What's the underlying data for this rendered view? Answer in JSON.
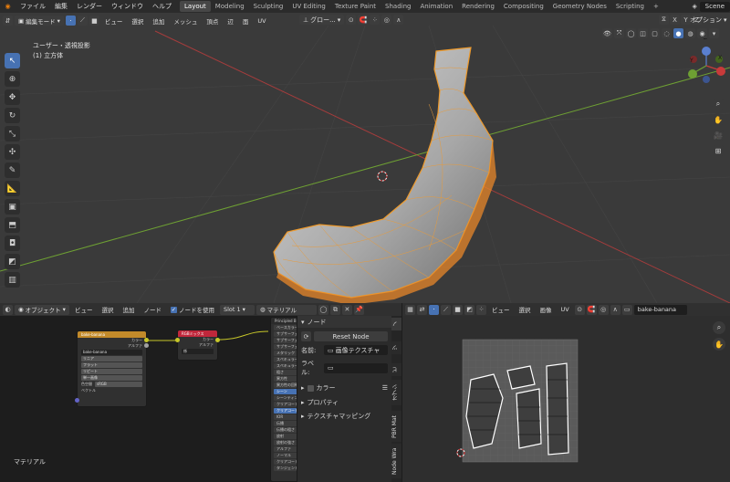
{
  "topbar": {
    "menus": [
      "ファイル",
      "編集",
      "レンダー",
      "ウィンドウ",
      "ヘルプ"
    ],
    "workspaces": [
      "Layout",
      "Modeling",
      "Sculpting",
      "UV Editing",
      "Texture Paint",
      "Shading",
      "Animation",
      "Rendering",
      "Compositing",
      "Geometry Nodes",
      "Scripting"
    ],
    "active_workspace": "Layout",
    "add_tab": "+",
    "scene": "Scene"
  },
  "viewport_header": {
    "mode": "編集モード",
    "menus": [
      "ビュー",
      "選択",
      "追加",
      "メッシュ",
      "頂点",
      "辺",
      "面",
      "UV"
    ],
    "orientation": "グロー...",
    "axes": [
      "X",
      "Y",
      "Z"
    ],
    "options": "オプション"
  },
  "viewport": {
    "view_name": "ユーザー・透視投影",
    "object_name": "(1) 立方体",
    "gizmo": {
      "x": "X",
      "y": "Y",
      "z": "Z"
    }
  },
  "colors": {
    "accent": "#4772b3",
    "selection": "#f5a623",
    "x_axis": "#a43c3c",
    "y_axis": "#6ea033",
    "image_node_header": "#c28a2a",
    "math_node_header": "#c0273b"
  },
  "node_header": {
    "editor_type": "オブジェクト",
    "menus": [
      "ビュー",
      "選択",
      "追加",
      "ノード"
    ],
    "use_nodes": "ノードを使用",
    "slot": "Slot 1",
    "material": "マテリアル"
  },
  "node_editor": {
    "material_label": "マテリアル",
    "image_node": {
      "title": "bake-banana",
      "out_color": "カラー",
      "out_alpha": "アルファ",
      "image": "bake-banana",
      "interpolation": "リニア",
      "projection": "フラット",
      "extension": "リピート",
      "source": "単一画像",
      "colorspace_label": "色空間",
      "colorspace": "sRGB",
      "vector": "ベクトル"
    },
    "math_node": {
      "title": "RGBミックス",
      "in_color": "カラー",
      "in_alpha": "アルファ",
      "factor": "係"
    },
    "bsdf_node": {
      "title": "Principled B",
      "inputs": [
        "ベースカラー",
        "サブサーフェ",
        "サブサーフェ",
        "サブサーフェ",
        "メタリック",
        "スペキュラー",
        "スペキュラー",
        "粗さ",
        "異方性",
        "異方性の回転",
        "シーン",
        "シーンティント",
        "クリアコート",
        "クリアコート",
        "IOR",
        "伝播",
        "伝播の粗さ",
        "放射",
        "放射の強さ",
        "アルファ",
        "ノーマル",
        "クリアコートの",
        "タンジェント"
      ]
    },
    "sidebar": {
      "section_node": "ノード",
      "reset_button": "Reset Node",
      "name_label": "名前:",
      "name_value": "画像テクスチャ",
      "label_label": "ラベル:",
      "color_label": "カラー",
      "properties": "プロパティ",
      "texture_mapping": "テクスチャマッピング"
    },
    "tabs": [
      "ノ",
      "ツ",
      "ビ",
      "オプシ",
      "PBR Mat",
      "Node Wra"
    ]
  },
  "uv_header": {
    "menus": [
      "ビュー",
      "選択",
      "画像",
      "UV"
    ],
    "image_name": "bake-banana"
  }
}
